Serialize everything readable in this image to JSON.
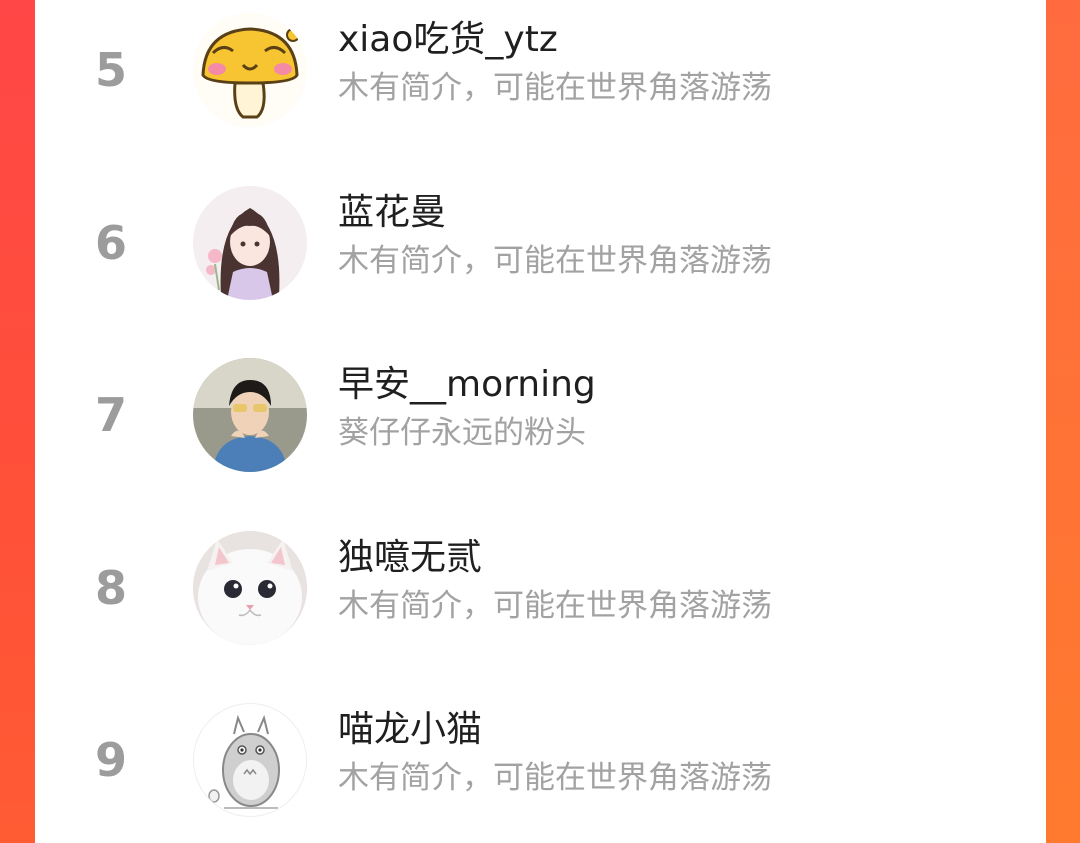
{
  "ranking": {
    "items": [
      {
        "rank": "5",
        "name": "xiao吃货_ytz",
        "bio": "木有简介，可能在世界角落游荡",
        "avatar_icon": "mushroom-cartoon-avatar"
      },
      {
        "rank": "6",
        "name": "蓝花曼",
        "bio": "木有简介，可能在世界角落游荡",
        "avatar_icon": "anime-girl-avatar"
      },
      {
        "rank": "7",
        "name": "早安__morning",
        "bio": "葵仔仔永远的粉头",
        "avatar_icon": "boy-photo-avatar"
      },
      {
        "rank": "8",
        "name": "独噫无贰",
        "bio": "木有简介，可能在世界角落游荡",
        "avatar_icon": "white-cat-avatar"
      },
      {
        "rank": "9",
        "name": "喵龙小猫",
        "bio": "木有简介，可能在世界角落游荡",
        "avatar_icon": "totoro-sketch-avatar"
      }
    ]
  },
  "colors": {
    "accent": "#ff4a4a",
    "rank": "#9c9c9c",
    "name": "#1f1f1f",
    "bio": "#a2a2a2"
  }
}
